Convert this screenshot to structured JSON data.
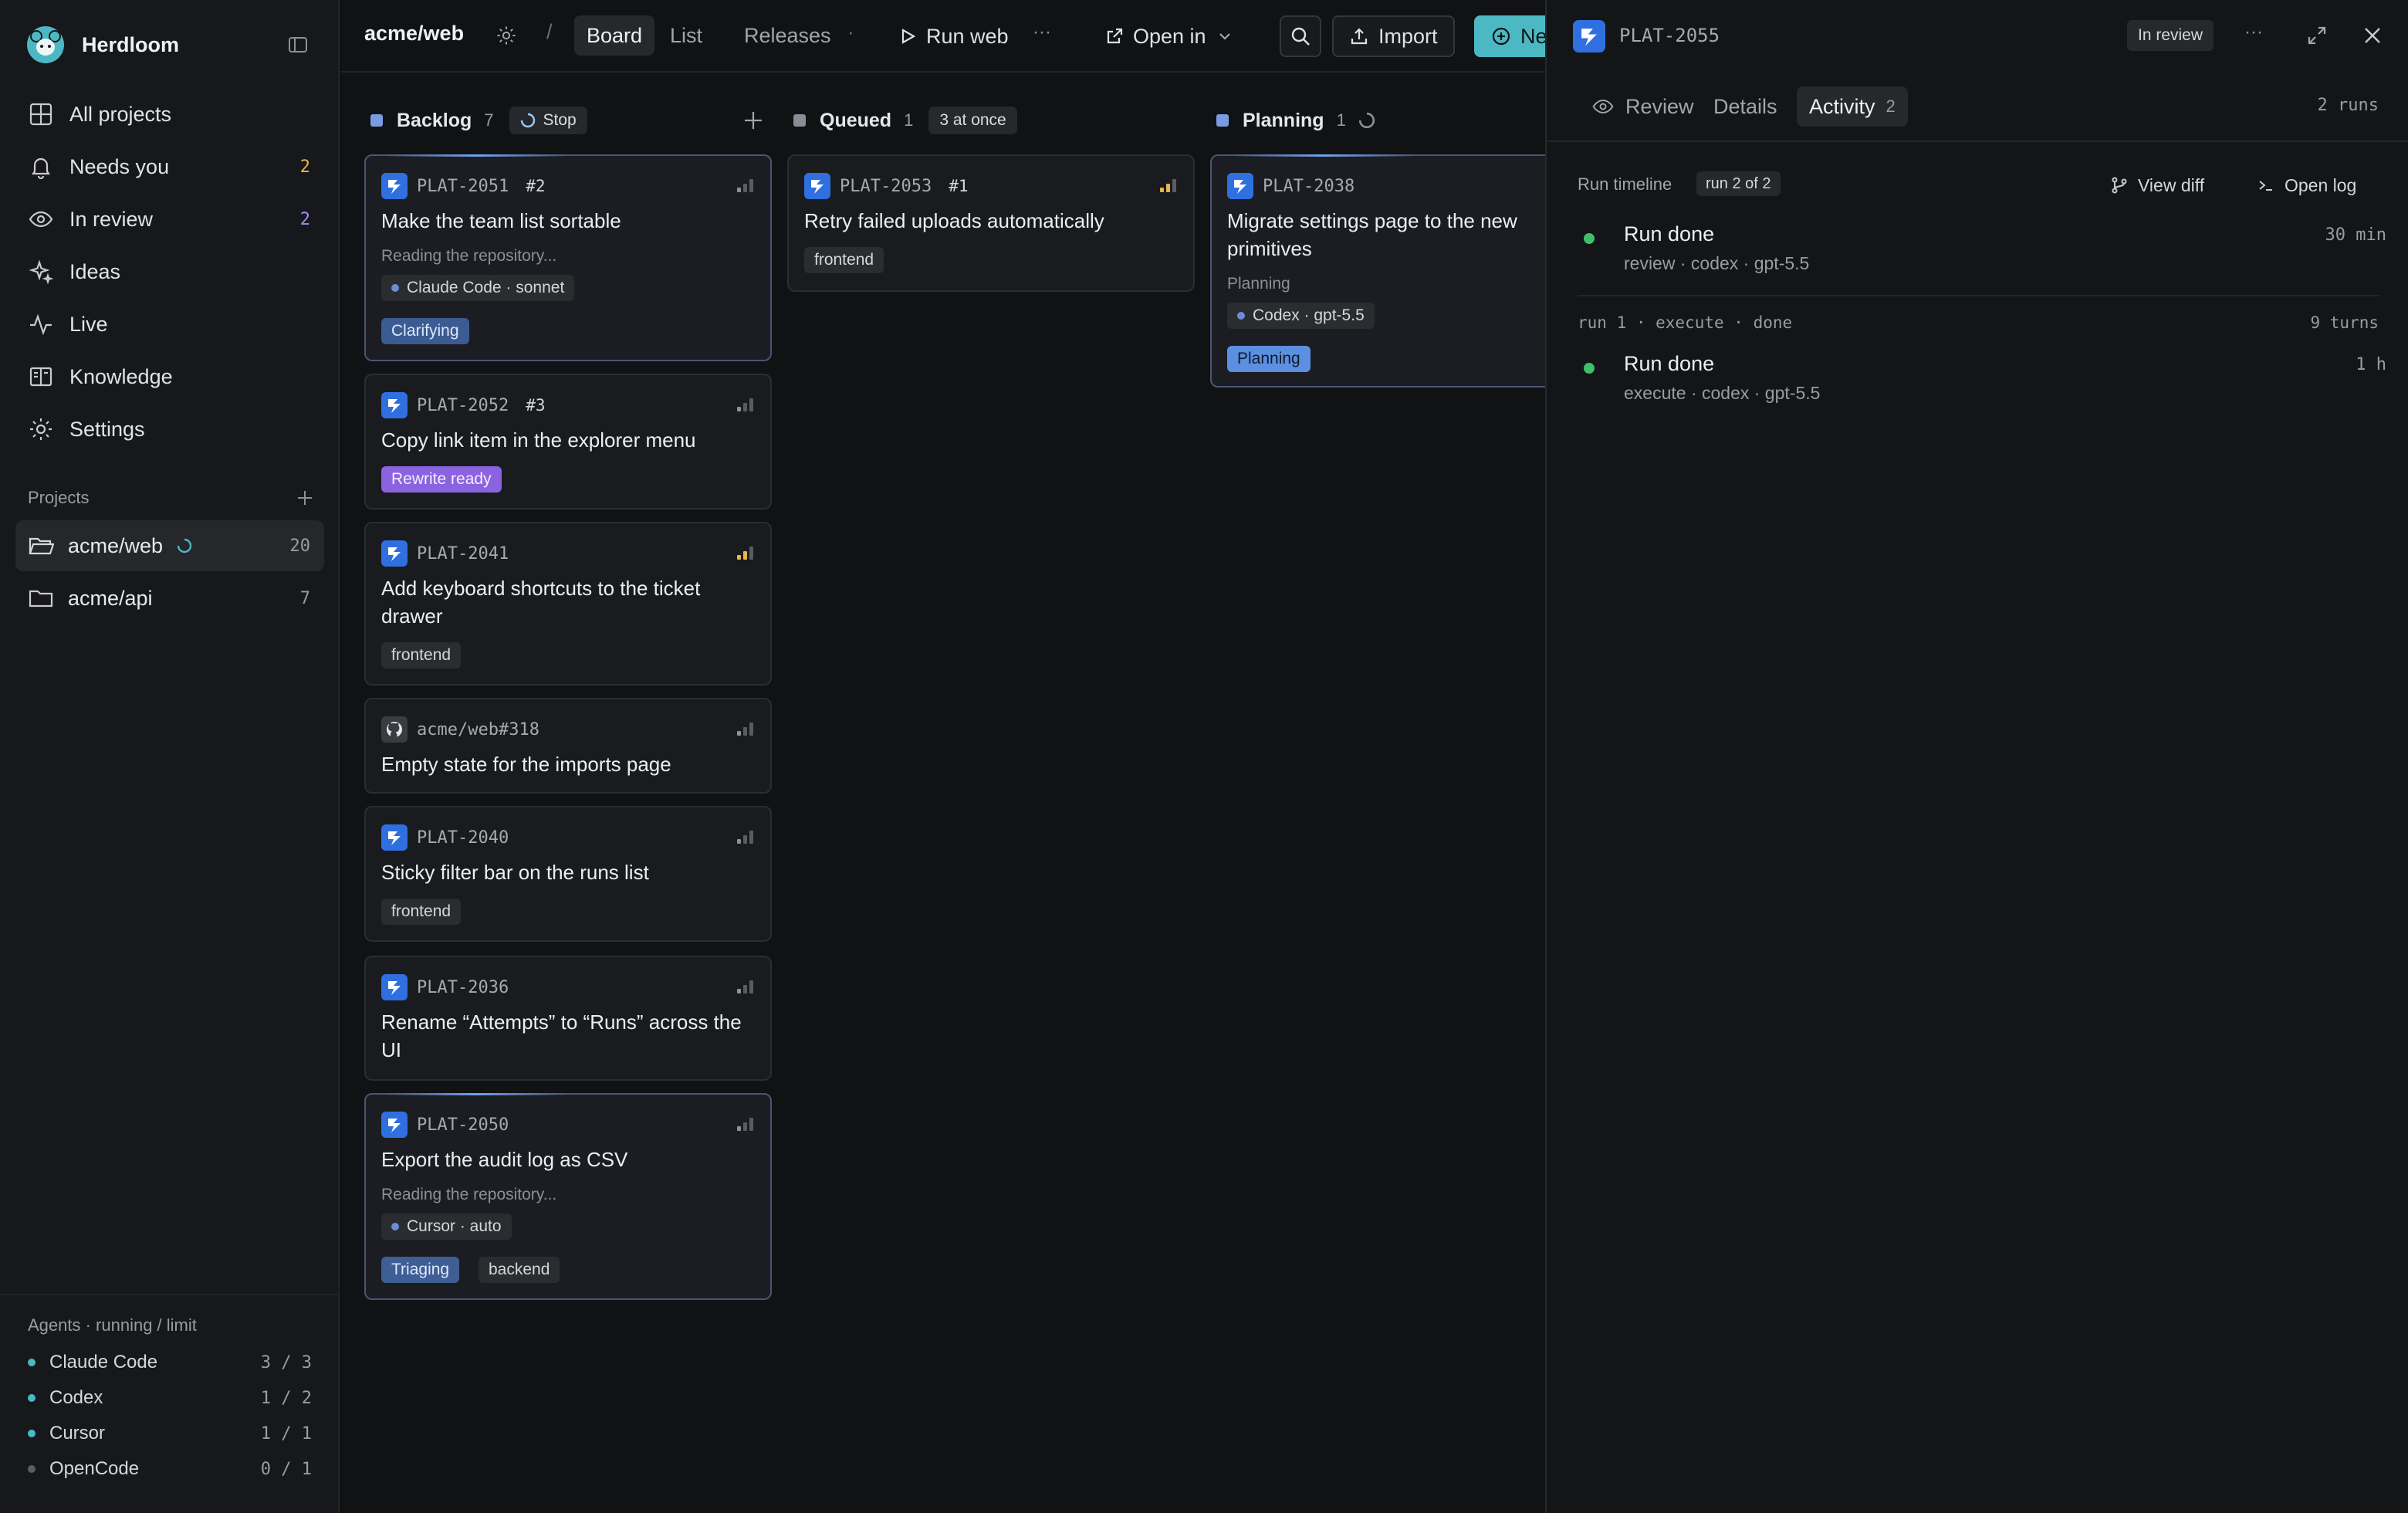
{
  "app": {
    "name": "Herdloom"
  },
  "sidebar": {
    "nav": [
      {
        "label": "All projects",
        "icon": "grid-icon"
      },
      {
        "label": "Needs you",
        "icon": "bell-icon",
        "count": "2",
        "count_color": "#e9b44c"
      },
      {
        "label": "In review",
        "icon": "eye-icon",
        "count": "2",
        "count_color": "#a78bfa"
      },
      {
        "label": "Ideas",
        "icon": "sparkles-icon"
      },
      {
        "label": "Live",
        "icon": "activity-icon"
      },
      {
        "label": "Knowledge",
        "icon": "book-icon"
      },
      {
        "label": "Settings",
        "icon": "gear-icon"
      }
    ],
    "projects_label": "Projects",
    "projects": [
      {
        "name": "acme/web",
        "count": "20",
        "active": true
      },
      {
        "name": "acme/api",
        "count": "7",
        "active": false
      }
    ],
    "agents_title": "Agents · running / limit",
    "agents": [
      {
        "name": "Claude Code",
        "usage": "3 / 3",
        "dot": "#4cb8c4"
      },
      {
        "name": "Codex",
        "usage": "1 / 2",
        "dot": "#4cb8c4"
      },
      {
        "name": "Cursor",
        "usage": "1 / 1",
        "dot": "#4cb8c4"
      },
      {
        "name": "OpenCode",
        "usage": "0 / 1",
        "dot": "#5a5c62"
      }
    ]
  },
  "topbar": {
    "project": "acme/web",
    "separator": "/",
    "tabs": [
      "Board",
      "List",
      "Releases"
    ],
    "dot": "·",
    "run_label": "Run web",
    "more": "···",
    "open_in": "Open in",
    "import_label": "Import",
    "new_label": "Ne"
  },
  "board": {
    "columns": [
      {
        "name": "Backlog",
        "count": "7",
        "pill": "Stop",
        "color": "#7b9be0"
      },
      {
        "name": "Queued",
        "count": "1",
        "pill": "3 at once",
        "color": "#8a8d93"
      },
      {
        "name": "Planning",
        "count": "1",
        "color": "#7b9be0"
      }
    ],
    "backlog": [
      {
        "id": "PLAT-2051",
        "num": "#2",
        "title": "Make the team list sortable",
        "sub": "Reading the repository...",
        "agent": "Claude Code · sonnet",
        "tags": [
          "Clarifying"
        ]
      },
      {
        "id": "PLAT-2052",
        "num": "#3",
        "title": "Copy link item in the explorer menu",
        "tags": [
          "Rewrite ready"
        ]
      },
      {
        "id": "PLAT-2041",
        "title": "Add keyboard shortcuts to the ticket drawer",
        "tags": [
          "frontend"
        ]
      },
      {
        "id": "acme/web#318",
        "title": "Empty state for the imports page"
      },
      {
        "id": "PLAT-2040",
        "title": "Sticky filter bar on the runs list",
        "tags": [
          "frontend"
        ]
      },
      {
        "id": "PLAT-2036",
        "title": "Rename “Attempts” to “Runs” across the UI"
      },
      {
        "id": "PLAT-2050",
        "title": "Export the audit log as CSV",
        "sub": "Reading the repository...",
        "agent": "Cursor · auto",
        "tags": [
          "Triaging",
          "backend"
        ]
      }
    ],
    "queued": [
      {
        "id": "PLAT-2053",
        "num": "#1",
        "title": "Retry failed uploads automatically",
        "tags": [
          "frontend"
        ]
      }
    ],
    "planning": [
      {
        "id": "PLAT-2038",
        "title": "Migrate settings page to the new primitives",
        "sub": "Planning",
        "agent": "Codex · gpt-5.5",
        "tags": [
          "Planning"
        ]
      }
    ]
  },
  "drawer": {
    "ticket_id": "PLAT-2055",
    "status": "In review",
    "more": "···",
    "tabs": [
      {
        "label": "Review"
      },
      {
        "label": "Details"
      },
      {
        "label": "Activity",
        "count": "2"
      }
    ],
    "runs_count": "2 runs",
    "timeline_label": "Run timeline",
    "timeline_badge": "run 2 of 2",
    "view_diff": "View diff",
    "open_log": "Open log",
    "runs": [
      {
        "title": "Run done",
        "sub": "review · codex · gpt-5.5",
        "time": "30 min"
      },
      {
        "group": "run 1 · execute · done",
        "group_meta": "9 turns",
        "title": "Run done",
        "sub": "execute · codex · gpt-5.5",
        "time": "1 h"
      }
    ]
  }
}
